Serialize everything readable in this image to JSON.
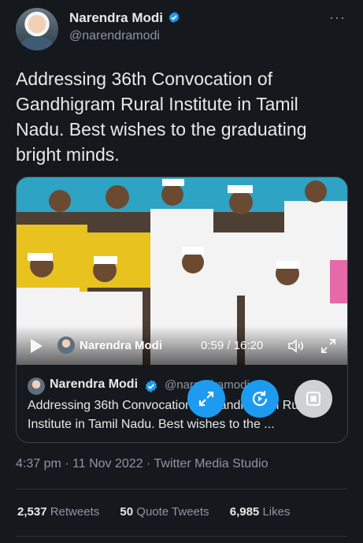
{
  "author": {
    "name": "Narendra Modi",
    "handle": "@narendramodi",
    "verified_icon": "verified-badge-icon"
  },
  "more_icon": "more-horizontal-icon",
  "tweet": {
    "text": "Addressing 36th Convocation of Gandhigram Rural Institute in Tamil Nadu. Best wishes to the graduating bright minds."
  },
  "video": {
    "channel_name": "Narendra Modi",
    "time": "0:59 / 16:20",
    "play_icon": "play-icon",
    "volume_icon": "volume-icon",
    "expand_icon": "expand-icon"
  },
  "quoted": {
    "name": "Narendra Modi",
    "handle": "@narendramodi",
    "text": "Addressing 36th Convocation of Gandhigram Rural Institute in Tamil Nadu. Best wishes to the ..."
  },
  "overlay_buttons": {
    "expand_icon": "expand-arrows-icon",
    "rotate_icon": "rotate-play-icon",
    "stop_icon": "stop-square-icon"
  },
  "meta": {
    "time": "4:37 pm",
    "sep": "·",
    "date": "11 Nov 2022",
    "source": "Twitter Media Studio"
  },
  "stats": {
    "retweets_count": "2,537",
    "retweets_label": "Retweets",
    "quotes_count": "50",
    "quotes_label": "Quote Tweets",
    "likes_count": "6,985",
    "likes_label": "Likes"
  },
  "colors": {
    "background": "#15181c",
    "accent": "#1d9bf0",
    "secondary_text": "#8b98a5"
  }
}
